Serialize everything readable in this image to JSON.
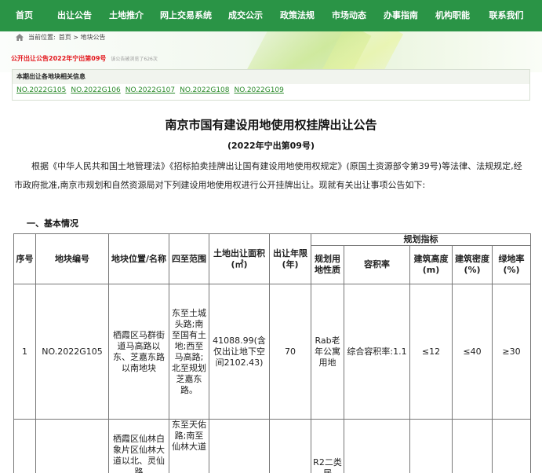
{
  "nav": {
    "items": [
      "首页",
      "出让公告",
      "土地推介",
      "网上交易系统",
      "成交公示",
      "政策法规",
      "市场动态",
      "办事指南",
      "机构职能",
      "联系我们"
    ]
  },
  "breadcrumb": {
    "prefix": "当前位置:",
    "path": "首页 > 地块公告"
  },
  "announcement": {
    "title": "公开出让公告2022年宁出第09号",
    "views": "该公告被浏览了626次"
  },
  "related": {
    "header": "本期出让各地块相关信息",
    "links": [
      "NO.2022G105",
      "NO.2022G106",
      "NO.2022G107",
      "NO.2022G108",
      "NO.2022G109"
    ]
  },
  "document": {
    "title": "南京市国有建设用地使用权挂牌出让公告",
    "subtitle": "(2022年宁出第09号)",
    "paragraph": "根据《中华人民共和国土地管理法》《招标拍卖挂牌出让国有建设用地使用权规定》(原国土资源部令第39号)等法律、法规规定,经市政府批准,南京市规划和自然资源局对下列建设用地使用权进行公开挂牌出让。现就有关出让事项公告如下:",
    "section": "一、基本情况"
  },
  "table": {
    "headers": {
      "seq": "序号",
      "code": "地块编号",
      "location": "地块位置/名称",
      "boundary": "四至范围",
      "area": "土地出让面积(㎡)",
      "term": "出让年限(年)",
      "indicators": "规划指标",
      "use": "规划用地性质",
      "far": "容积率",
      "height": "建筑高度(m)",
      "density": "建筑密度(%)",
      "green": "绿地率(%)"
    },
    "rows": [
      {
        "seq": "1",
        "code": "NO.2022G105",
        "location": "栖霞区马群街道马高路以东、芝嘉东路以南地块",
        "boundary": "东至土城头路;南至国有土地;西至马高路;北至规划芝嘉东路。",
        "area": "41088.99(含仅出让地下空间2102.43)",
        "term": "70",
        "use": "Rab老年公寓用地",
        "far": "综合容积率:1.1",
        "height": "≤12",
        "density": "≤40",
        "green": "≥30"
      },
      {
        "seq": "",
        "code": "",
        "location": "栖霞区仙林白象片区仙林大道以北、灵仙路",
        "boundary": "东至天佑路;南至仙林大道",
        "area": "",
        "term": "",
        "use": "R2二类居",
        "far": "",
        "height": "",
        "density": "",
        "green": ""
      }
    ]
  },
  "colors": {
    "nav_bg": "#2a9446",
    "announcement_red": "#e3151b",
    "link_green": "#2a8a2a"
  }
}
